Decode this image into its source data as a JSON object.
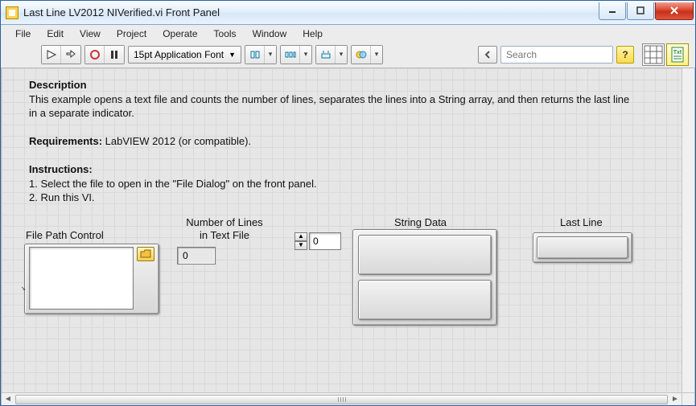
{
  "window": {
    "title": "Last Line LV2012 NIVerified.vi Front Panel"
  },
  "menu": {
    "file": "File",
    "edit": "Edit",
    "view": "View",
    "project": "Project",
    "operate": "Operate",
    "tools": "Tools",
    "window": "Window",
    "help": "Help"
  },
  "toolbar": {
    "font_label": "15pt Application Font",
    "search_placeholder": "Search",
    "help_label": "?"
  },
  "description": {
    "heading": "Description",
    "body1": "This example opens a text file and counts the number of lines, separates the lines into a String array, and then returns the last line",
    "body2": "in a separate indicator.",
    "req_label": "Requirements:",
    "req_text": " LabVIEW 2012 (or compatible).",
    "instr_label": "Instructions:",
    "instr1": "1. Select the file to open in the \"File Dialog\" on the front panel.",
    "instr2": "2. Run this VI."
  },
  "controls": {
    "file_path_label": "File Path Control",
    "file_path_value": "",
    "num_lines_label1": "Number of Lines",
    "num_lines_label2": "in Text File",
    "num_lines_value": "0",
    "array_index_value": "0",
    "string_data_label": "String Data",
    "string_cell0": "",
    "string_cell1": "",
    "last_line_label": "Last Line",
    "last_line_value": ""
  }
}
